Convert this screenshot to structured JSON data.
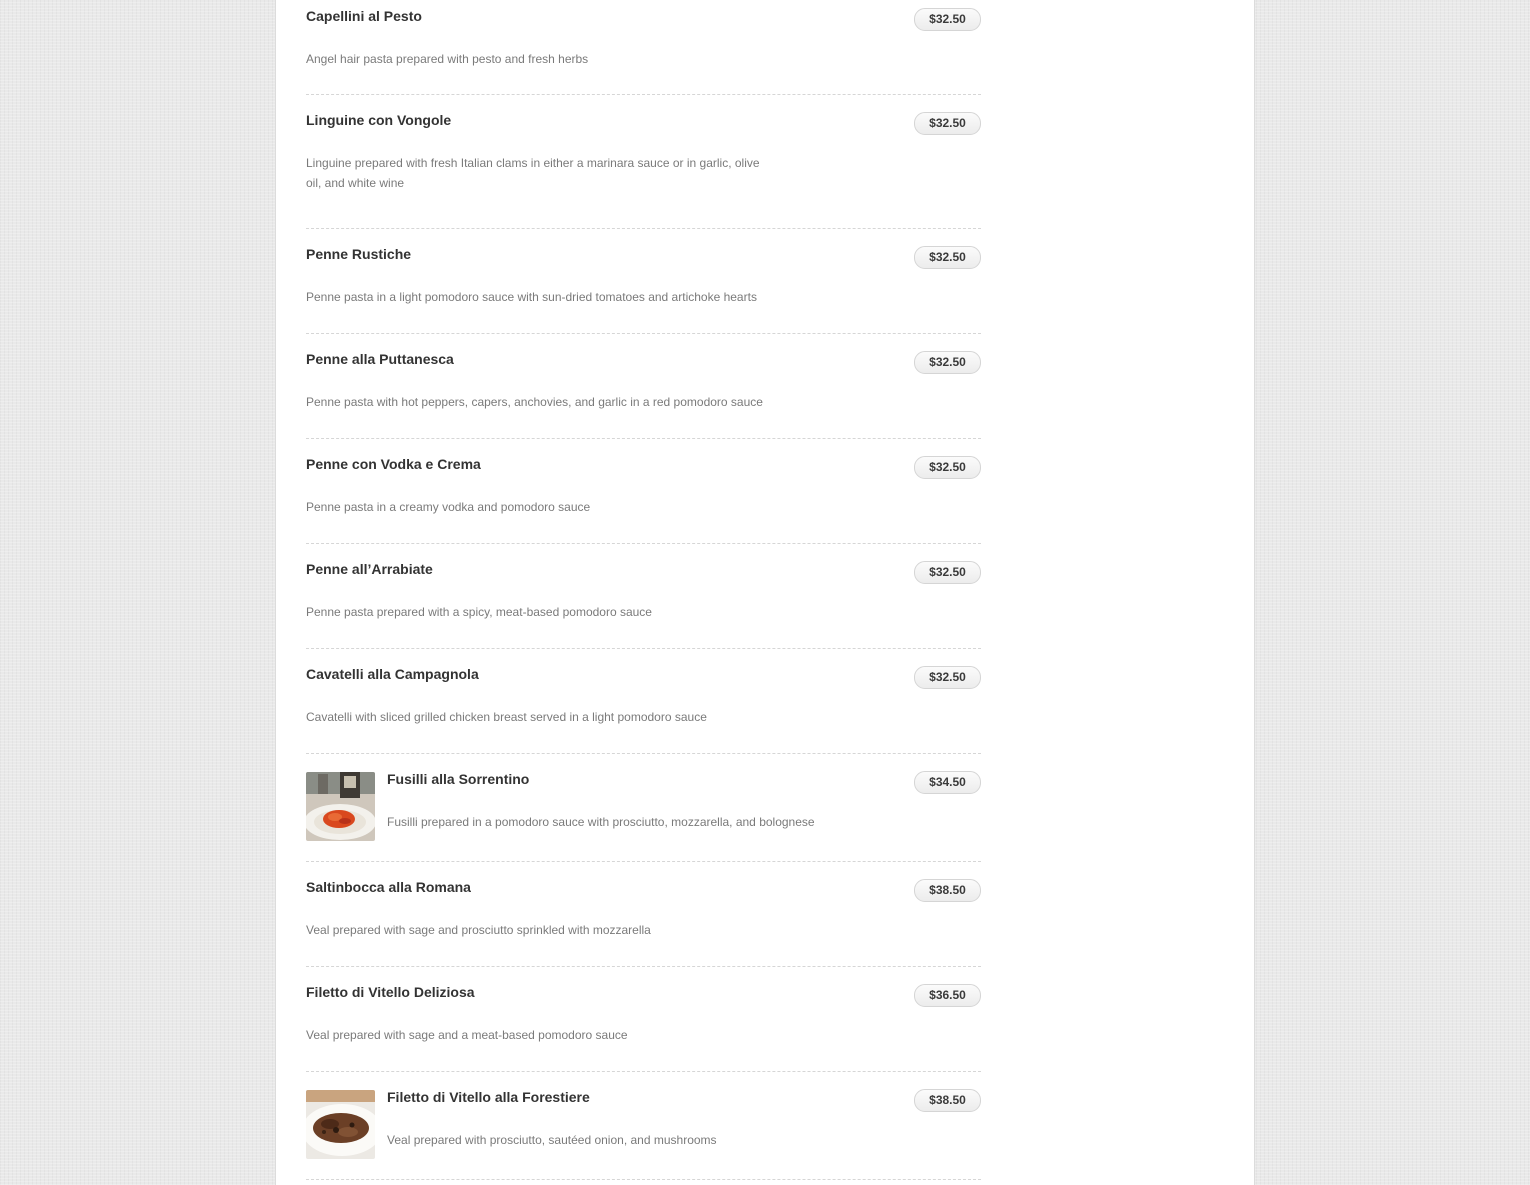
{
  "menu": {
    "items": [
      {
        "name": "Capellini al Pesto",
        "description": "Angel hair pasta prepared with pesto and fresh herbs",
        "price": "$32.50"
      },
      {
        "name": "Linguine con Vongole",
        "description": "Linguine prepared with fresh Italian clams in either a marinara sauce or in garlic, olive oil, and white wine",
        "price": "$32.50"
      },
      {
        "name": "Penne Rustiche",
        "description": "Penne pasta in a light pomodoro sauce with sun-dried tomatoes and artichoke hearts",
        "price": "$32.50"
      },
      {
        "name": "Penne alla Puttanesca",
        "description": "Penne pasta with hot peppers, capers, anchovies, and garlic in a red pomodoro sauce",
        "price": "$32.50"
      },
      {
        "name": "Penne con Vodka e Crema",
        "description": "Penne pasta in a creamy vodka and pomodoro sauce",
        "price": "$32.50"
      },
      {
        "name": "Penne all’Arrabiate",
        "description": "Penne pasta prepared with a spicy, meat-based pomodoro sauce",
        "price": "$32.50"
      },
      {
        "name": "Cavatelli alla Campagnola",
        "description": "Cavatelli with sliced grilled chicken breast served in a light pomodoro sauce",
        "price": "$32.50"
      },
      {
        "name": "Fusilli alla Sorrentino",
        "description": "Fusilli prepared in a pomodoro sauce with prosciutto, mozzarella, and bolognese",
        "price": "$34.50"
      },
      {
        "name": "Saltinbocca alla Romana",
        "description": "Veal prepared with sage and prosciutto sprinkled with mozzarella",
        "price": "$38.50"
      },
      {
        "name": "Filetto di Vitello Deliziosa",
        "description": "Veal prepared with sage and a meat-based pomodoro sauce",
        "price": "$36.50"
      },
      {
        "name": "Filetto di Vitello alla Forestiere",
        "description": "Veal prepared with prosciutto, sautéed onion, and mushrooms",
        "price": "$38.50"
      }
    ]
  }
}
